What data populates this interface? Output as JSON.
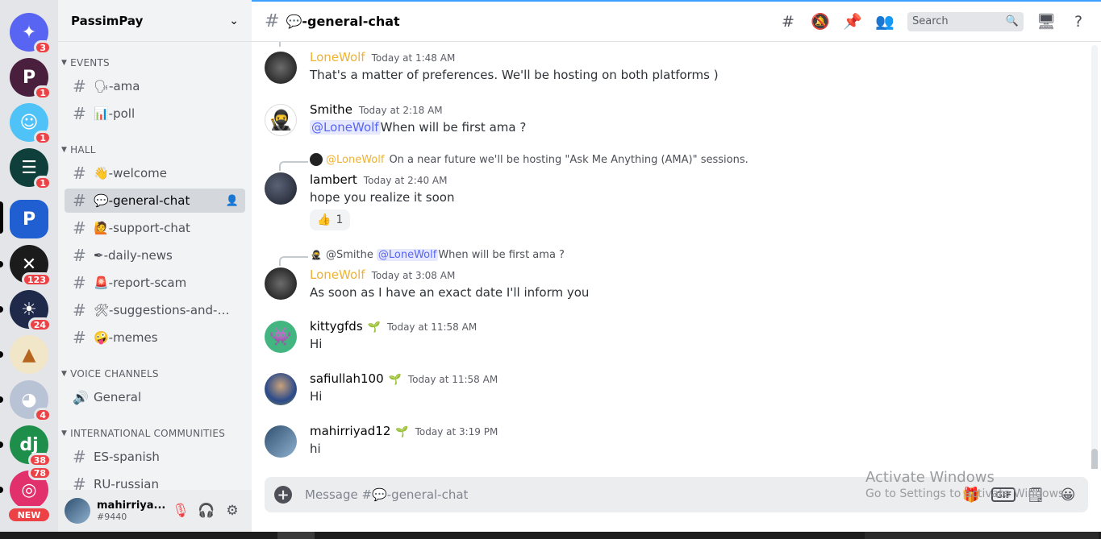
{
  "server_rail": {
    "servers": [
      {
        "name": "discord-home",
        "color": "#5865f2",
        "glyph": "✦",
        "badge": "3"
      },
      {
        "name": "server-p",
        "color": "#4a1f3d",
        "glyph": "P",
        "badge": "1"
      },
      {
        "name": "server-smiley",
        "color": "#4fc3f7",
        "glyph": "☺",
        "badge": "1"
      },
      {
        "name": "server-checklist",
        "color": "#0f3f3a",
        "glyph": "☰",
        "badge": "1"
      },
      {
        "name": "server-passimpay",
        "color": "#1f5fd1",
        "glyph": "P",
        "badge": ""
      },
      {
        "name": "server-bone",
        "color": "#1b1b1b",
        "glyph": "✕",
        "badge": "123"
      },
      {
        "name": "server-sun",
        "color": "#1f2a4a",
        "glyph": "☀",
        "badge": "24"
      },
      {
        "name": "server-temple",
        "color": "#f2e6c9",
        "glyph": "▲",
        "badge": ""
      },
      {
        "name": "server-dog",
        "color": "#b9c3d6",
        "glyph": "◕",
        "badge": "4"
      },
      {
        "name": "server-dj",
        "color": "#1e8f4a",
        "glyph": "dj",
        "badge": "38"
      },
      {
        "name": "server-instagram",
        "color": "#e1306c",
        "glyph": "◎",
        "badge": "78"
      }
    ],
    "new_label": "NEW"
  },
  "sidebar": {
    "guild_name": "PassimPay",
    "categories": {
      "events": "EVENTS",
      "hall": "HALL",
      "voice": "VOICE CHANNELS",
      "international": "INTERNATIONAL COMMUNITIES"
    },
    "channels": {
      "ama": "🗣-ama",
      "poll": "📊-poll",
      "welcome": "👋-welcome",
      "general_chat": "💬-general-chat",
      "support_chat": "🙋-support-chat",
      "daily_news": "✒-daily-news",
      "report_scam": "🚨-report-scam",
      "suggestions": "🛠-suggestions-and-fe...",
      "memes": "🤪-memes",
      "voice_general": "General",
      "spanish": "ES-spanish",
      "russian": "RU-russian"
    },
    "user": {
      "name": "mahirriya...",
      "tag": "#9440"
    }
  },
  "main": {
    "channel_title": "💬-general-chat",
    "search_placeholder": "Search",
    "composer_placeholder": "Message #💬-general-chat",
    "messages": [
      {
        "author": "LoneWolf",
        "time": "Today at 1:48 AM",
        "text": "That's a matter of preferences. We'll be hosting on both platforms )"
      },
      {
        "author": "Smithe",
        "time": "Today at 2:18 AM",
        "mention": "@LoneWolf",
        "text": "When will be first ama ?"
      },
      {
        "reply_name": "@LoneWolf",
        "reply_text": "On a near future we'll be hosting \"Ask Me Anything (AMA)\" sessions.",
        "author": "lambert",
        "time": "Today at 2:40 AM",
        "text": "hope you realize it soon",
        "reaction_emoji": "👍",
        "reaction_count": "1"
      },
      {
        "reply_name": "@Smithe",
        "reply_mention": "@LoneWolf",
        "reply_text": "When will be first ama ?",
        "author": "LoneWolf",
        "time": "Today at 3:08 AM",
        "text": "As soon as I have an exact date I'll inform you"
      },
      {
        "author": "kittygfds",
        "time": "Today at 11:58 AM",
        "text": "Hi"
      },
      {
        "author": "safiullah100",
        "time": "Today at 11:58 AM",
        "text": "Hi"
      },
      {
        "author": "mahirriyad12",
        "time": "Today at 3:19 PM",
        "text": "hi"
      }
    ]
  },
  "watermark": {
    "line1": "Activate Windows",
    "line2": "Go to Settings to activate Windows."
  },
  "colors": {
    "gold_author": "#f0b232",
    "mention": "#5865f2",
    "badge": "#ed4245"
  }
}
